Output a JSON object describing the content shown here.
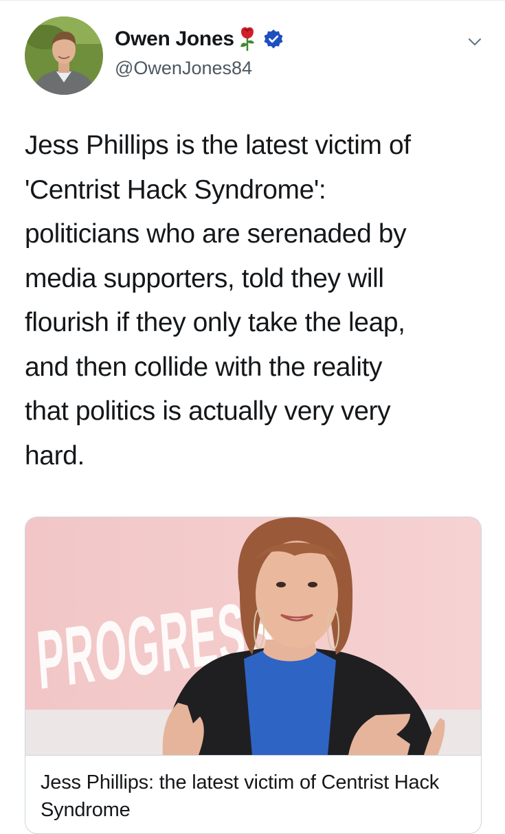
{
  "tweet": {
    "author": {
      "name": "Owen Jones",
      "handle": "@OwenJones84",
      "name_emoji": "rose-emoji",
      "verified_icon": "verified-badge-icon"
    },
    "menu_icon": "chevron-down-icon",
    "text": "Jess Phillips is the latest victim of\n'Centrist Hack Syndrome':\npoliticians who are serenaded by\nmedia supporters, told they will\nflourish if they only take the leap,\nand then collide with the reality\nthat politics is actually very very\nhard.",
    "card": {
      "image_subject": "Jess Phillips speaking on stage",
      "image_backdrop_text": "PROGRESS",
      "title": "Jess Phillips: the latest victim of Centrist Hack Syndrome"
    }
  },
  "colors": {
    "text": "#14171a",
    "handle": "#4c5862",
    "verified": "#1d4fbf",
    "border": "#ccd6dd",
    "backdrop": "#f4cfcf"
  }
}
